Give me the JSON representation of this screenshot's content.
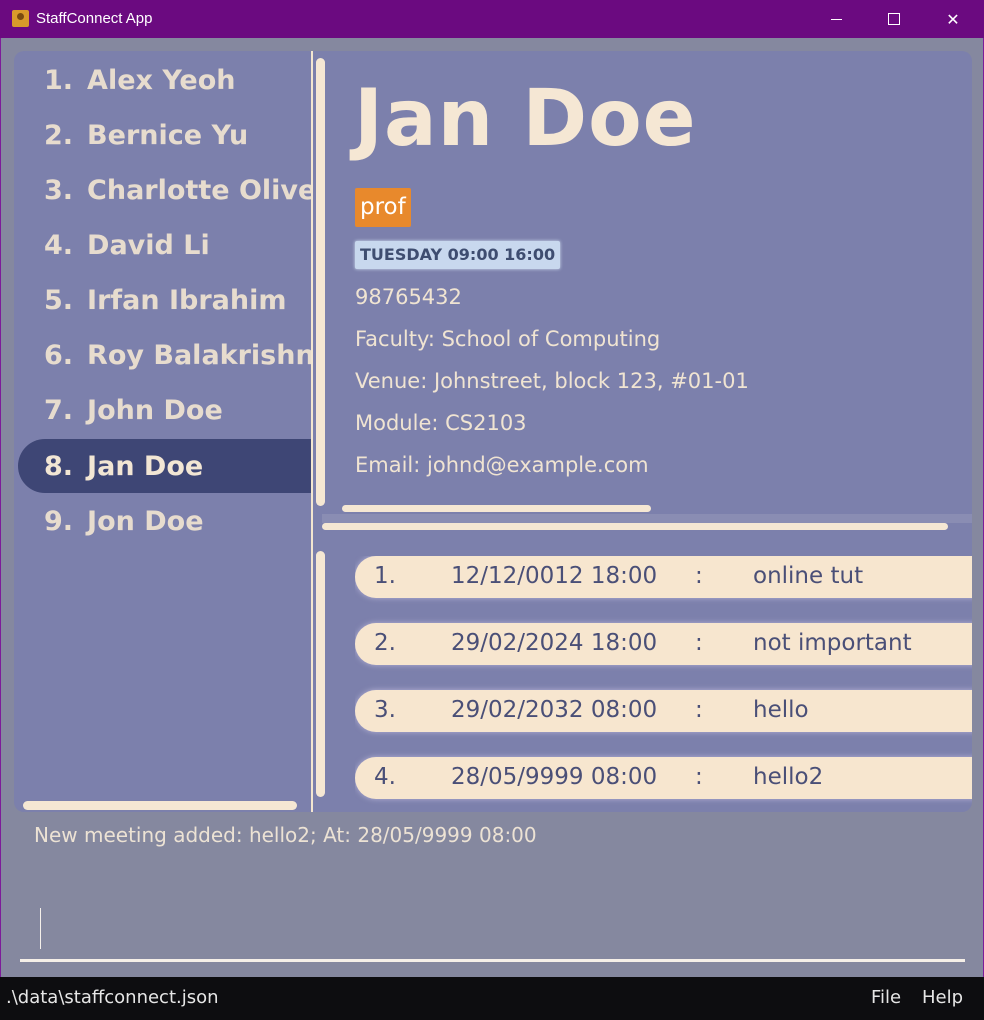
{
  "window": {
    "title": "StaffConnect App",
    "icon": "staffconnect-app-icon",
    "controls": {
      "minimize": "minimize-icon",
      "maximize": "maximize-icon",
      "close": "close-icon"
    }
  },
  "person_list": [
    {
      "index": "1.",
      "name": "Alex Yeoh"
    },
    {
      "index": "2.",
      "name": "Bernice Yu"
    },
    {
      "index": "3.",
      "name": "Charlotte Oliveiro"
    },
    {
      "index": "4.",
      "name": "David Li"
    },
    {
      "index": "5.",
      "name": "Irfan Ibrahim"
    },
    {
      "index": "6.",
      "name": "Roy Balakrishnan"
    },
    {
      "index": "7.",
      "name": "John Doe"
    },
    {
      "index": "8.",
      "name": "Jan Doe",
      "selected": true
    },
    {
      "index": "9.",
      "name": "Jon Doe"
    }
  ],
  "detail": {
    "name": "Jan Doe",
    "tag": "prof",
    "availability": "TUESDAY 09:00 16:00",
    "phone": "98765432",
    "faculty": "Faculty:  School of Computing",
    "venue": "Venue:  Johnstreet, block 123, #01-01",
    "module": "Module:  CS2103",
    "email": "Email:  johnd@example.com"
  },
  "meetings": [
    {
      "index": "1.",
      "datetime": "12/12/0012 18:00",
      "sep": ":",
      "description": "online tut"
    },
    {
      "index": "2.",
      "datetime": "29/02/2024 18:00",
      "sep": ":",
      "description": "not important"
    },
    {
      "index": "3.",
      "datetime": "29/02/2032 08:00",
      "sep": ":",
      "description": "hello"
    },
    {
      "index": "4.",
      "datetime": "28/05/9999 08:00",
      "sep": ":",
      "description": "hello2"
    }
  ],
  "result_message": "New meeting added: hello2; At: 28/05/9999 08:00",
  "command_input": {
    "value": ""
  },
  "status_bar": {
    "path": ".\\data\\staffconnect.json",
    "menu_file": "File",
    "menu_help": "Help"
  },
  "colors": {
    "titlebar": "#6b0a80",
    "background": "#85889f",
    "panel": "#7c80ac",
    "selected_item": "#3e4675",
    "tag": "#e8892c",
    "meeting_card": "#f7e6cf"
  }
}
